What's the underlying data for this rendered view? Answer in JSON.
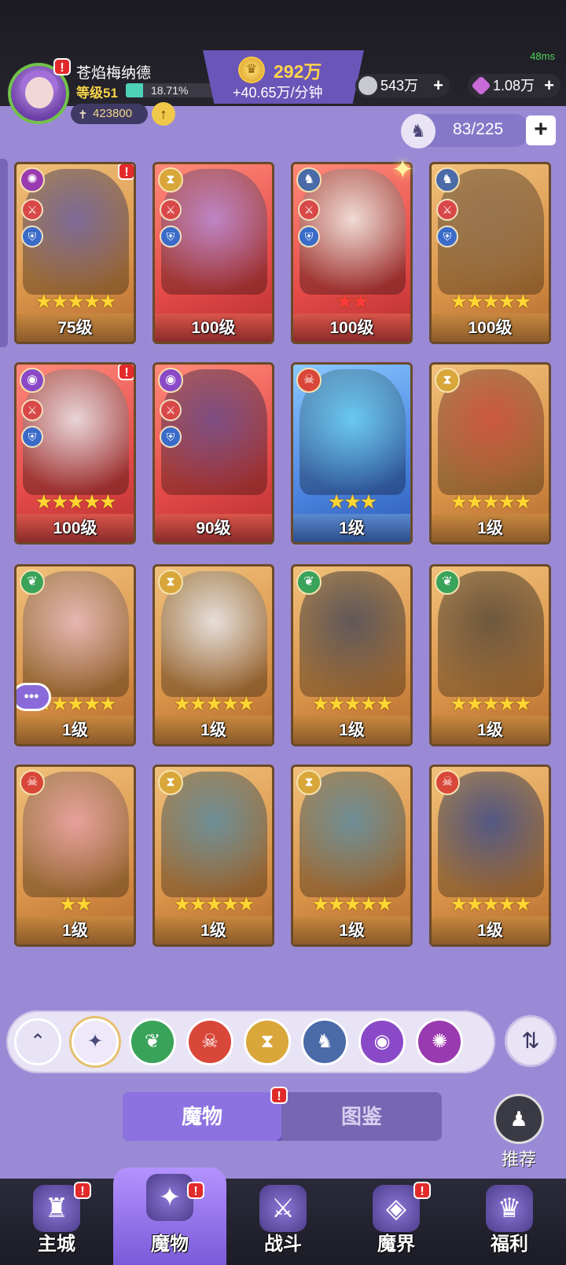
{
  "status": {
    "ping": "48ms"
  },
  "player": {
    "name": "苍焰梅纳德",
    "level": "等级51",
    "xp_percent": "18.71%",
    "xp_fraction": 0.1871,
    "power": "423800"
  },
  "currency": {
    "gold": "292万",
    "gold_rate": "+40.65万/分钟",
    "silver": "543万",
    "gems": "1.08万"
  },
  "collection": {
    "count": "83/225"
  },
  "cards": [
    {
      "level": "75级",
      "stars": "★★★★★",
      "faction_icon": "spiral-icon",
      "bg": "gold",
      "art": "#6b5fa0",
      "has_roles": true,
      "notif": true
    },
    {
      "level": "100级",
      "stars": "",
      "faction_icon": "hourglass-icon",
      "bg": "red",
      "art": "#b58ad8",
      "has_roles": true,
      "notif": false
    },
    {
      "level": "100级",
      "stars": "★★",
      "star_color": "red",
      "faction_icon": "dragon-icon",
      "bg": "red",
      "art": "#f0efe8",
      "has_roles": true,
      "notif": false
    },
    {
      "level": "100级",
      "stars": "★★★★★",
      "faction_icon": "dragon-icon",
      "bg": "gold",
      "art": "#8a6a4a",
      "has_roles": true,
      "notif": false
    },
    {
      "level": "100级",
      "stars": "★★★★★",
      "faction_icon": "eye-icon",
      "bg": "red",
      "art": "#e8e8ef",
      "has_roles": true,
      "notif": true
    },
    {
      "level": "90级",
      "stars": "",
      "faction_icon": "eye-icon",
      "bg": "red",
      "art": "#6a4a8a",
      "has_roles": true,
      "notif": false
    },
    {
      "level": "1级",
      "stars": "★★★",
      "faction_icon": "demon-icon",
      "bg": "blue",
      "art": "#6ad0f0",
      "has_roles": false,
      "notif": false
    },
    {
      "level": "1级",
      "stars": "★★★★★",
      "faction_icon": "hourglass-icon",
      "bg": "gold",
      "art": "#c94a3a",
      "has_roles": false,
      "notif": false
    },
    {
      "level": "1级",
      "stars": "★★★★★",
      "faction_icon": "leaf-icon",
      "bg": "gold",
      "art": "#e8b8c0",
      "has_roles": false,
      "notif": false,
      "chat": true
    },
    {
      "level": "1级",
      "stars": "★★★★★",
      "faction_icon": "hourglass-icon",
      "bg": "gold",
      "art": "#e8e8ef",
      "has_roles": false,
      "notif": false
    },
    {
      "level": "1级",
      "stars": "★★★★★",
      "faction_icon": "leaf-icon",
      "bg": "gold",
      "art": "#4a4a58",
      "has_roles": false,
      "notif": false
    },
    {
      "level": "1级",
      "stars": "★★★★★",
      "faction_icon": "leaf-icon",
      "bg": "gold",
      "art": "#5a4a38",
      "has_roles": false,
      "notif": false
    },
    {
      "level": "1级",
      "stars": "★★",
      "faction_icon": "demon-icon",
      "bg": "gold",
      "art": "#e8a0a8",
      "has_roles": false,
      "notif": false
    },
    {
      "level": "1级",
      "stars": "★★★★★",
      "faction_icon": "hourglass-icon",
      "bg": "gold",
      "art": "#5a8aa0",
      "has_roles": false,
      "notif": false
    },
    {
      "level": "1级",
      "stars": "★★★★★",
      "faction_icon": "hourglass-icon",
      "bg": "gold",
      "art": "#5a8aa0",
      "has_roles": false,
      "notif": false
    },
    {
      "level": "1级",
      "stars": "★★★★★",
      "faction_icon": "demon-icon",
      "bg": "gold",
      "art": "#3a4a8a",
      "has_roles": false,
      "notif": false
    }
  ],
  "filters": [
    {
      "name": "collapse-button",
      "glyph": "⌃",
      "color": "#e8e3f5",
      "fg": "#3a3560"
    },
    {
      "name": "filter-all",
      "glyph": "✦",
      "color": "#efe8fa",
      "fg": "#4a4a7a",
      "selected": true
    },
    {
      "name": "filter-leaf",
      "glyph": "❦",
      "color": "#3aa35a",
      "fg": "#fff"
    },
    {
      "name": "filter-demon",
      "glyph": "☠",
      "color": "#d9473a",
      "fg": "#fff"
    },
    {
      "name": "filter-hourglass",
      "glyph": "⧗",
      "color": "#d9a63a",
      "fg": "#fff"
    },
    {
      "name": "filter-dragon",
      "glyph": "♞",
      "color": "#4a6aa8",
      "fg": "#fff"
    },
    {
      "name": "filter-eye",
      "glyph": "◉",
      "color": "#8a4ac8",
      "fg": "#fff"
    },
    {
      "name": "filter-spiral",
      "glyph": "✺",
      "color": "#9a3ab0",
      "fg": "#fff"
    }
  ],
  "tabs": {
    "monsters": "魔物",
    "codex": "图鉴"
  },
  "recommend": "推荐",
  "nav": [
    {
      "label": "主城",
      "icon": "castle-icon",
      "glyph": "♜",
      "notif": true
    },
    {
      "label": "魔物",
      "icon": "flame-icon",
      "glyph": "✦",
      "notif": true,
      "active": true
    },
    {
      "label": "战斗",
      "icon": "sword-icon",
      "glyph": "⚔",
      "notif": false
    },
    {
      "label": "魔界",
      "icon": "portal-icon",
      "glyph": "◈",
      "notif": true
    },
    {
      "label": "福利",
      "icon": "chest-icon",
      "glyph": "♛",
      "notif": false
    }
  ]
}
